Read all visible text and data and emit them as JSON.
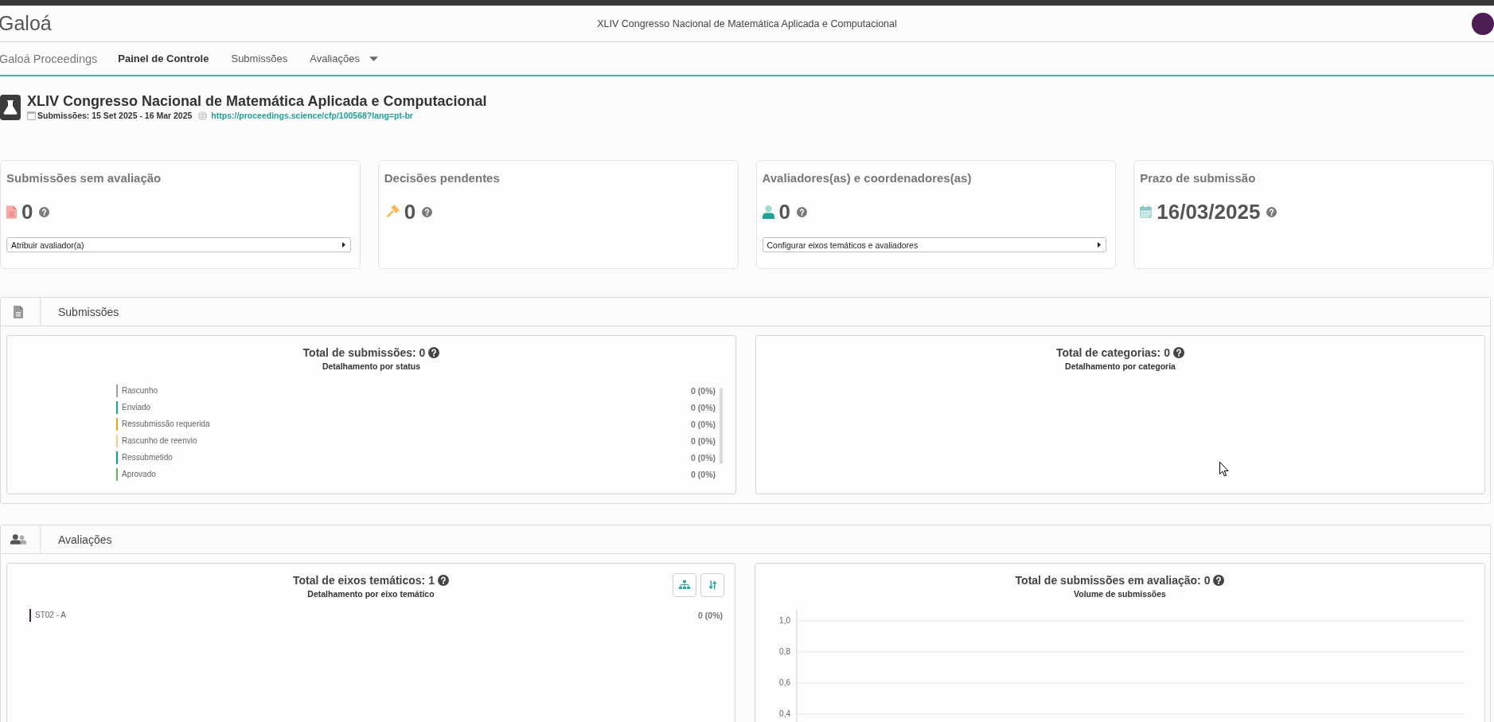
{
  "header": {
    "logo": "Galoá",
    "title": "XLIV Congresso Nacional de Matemática Aplicada e Computacional"
  },
  "nav": [
    {
      "label": "Galoá Proceedings",
      "kind": "brand",
      "selected": false
    },
    {
      "label": "Painel de Controle",
      "kind": "link",
      "selected": true
    },
    {
      "label": "Submissões",
      "kind": "link",
      "selected": false
    },
    {
      "label": "Avaliações",
      "kind": "dropdown",
      "selected": false
    }
  ],
  "event": {
    "title": "XLIV Congresso Nacional de Matemática Aplicada e Computacional",
    "dates": "Submissões: 15 Set 2025 - 16 Mar 2025",
    "url": "https://proceedings.science/cfp/100568?lang=pt-br"
  },
  "cards": [
    {
      "title": "Submissões sem avaliação",
      "kind": "document",
      "value": "0",
      "action": "Atribuir avaliador(a)"
    },
    {
      "title": "Decisões pendentes",
      "kind": "gavel",
      "value": "0"
    },
    {
      "title": "Avaliadores(as) e coordenadores(as)",
      "kind": "person",
      "value": "0",
      "action": "Configurar eixos temáticos e avaliadores"
    },
    {
      "title": "Prazo de submissão",
      "kind": "calendar",
      "value": "16/03/2025"
    }
  ],
  "sections": [
    {
      "title": "Submissões",
      "kind": "document",
      "panels": [
        {
          "kind": "status",
          "title": "Total de submissões: 0",
          "subtitle": "Detalhamento por status",
          "rows": [
            {
              "label": "Rascunho",
              "value": "0 (0%)",
              "color": "#9e9e9e"
            },
            {
              "label": "Enviado",
              "value": "0 (0%)",
              "color": "#1ba39c"
            },
            {
              "label": "Ressubmissão requerida",
              "value": "0 (0%)",
              "color": "#f2a516"
            },
            {
              "label": "Rascunho de reenvio",
              "value": "0 (0%)",
              "color": "#f8c98a"
            },
            {
              "label": "Ressubmetido",
              "value": "0 (0%)",
              "color": "#139e9e"
            },
            {
              "label": "Aprovado",
              "value": "0 (0%)",
              "color": "#5cb85c"
            }
          ]
        },
        {
          "kind": "empty",
          "title": "Total de categorias: 0",
          "subtitle": "Detalhamento por categoria"
        }
      ]
    },
    {
      "title": "Avaliações",
      "kind": "people",
      "panels": [
        {
          "kind": "axis",
          "title": "Total de eixos temáticos: 1",
          "subtitle": "Detalhamento por eixo temático",
          "tools": [
            {
              "kind": "hierarchy"
            },
            {
              "kind": "sort"
            }
          ],
          "rows": [
            {
              "label": "ST02 - A",
              "value": "0 (0%)",
              "color": "#4a1d4f"
            }
          ]
        },
        {
          "kind": "plot",
          "title": "Total de submissões em avaliação: 0",
          "subtitle": "Volume de submissões",
          "axis_labels": [
            "1,0",
            "0,8",
            "0,6",
            "0,4"
          ]
        }
      ]
    }
  ]
}
